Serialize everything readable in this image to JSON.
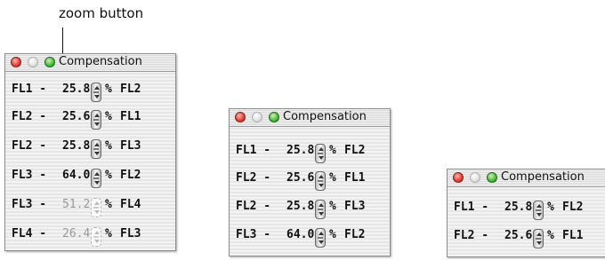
{
  "callout": {
    "label": "zoom button"
  },
  "windows": [
    {
      "title": "Compensation",
      "rows": [
        {
          "src": "FL1 -",
          "value": "25.8",
          "pct": "%",
          "dst": "FL2",
          "enabled": true
        },
        {
          "src": "FL2 -",
          "value": "25.6",
          "pct": "%",
          "dst": "FL1",
          "enabled": true
        },
        {
          "src": "FL2 -",
          "value": "25.8",
          "pct": "%",
          "dst": "FL3",
          "enabled": true
        },
        {
          "src": "FL3 -",
          "value": "64.0",
          "pct": "%",
          "dst": "FL2",
          "enabled": true
        },
        {
          "src": "FL3 -",
          "value": "51.2",
          "pct": "%",
          "dst": "FL4",
          "enabled": false
        },
        {
          "src": "FL4 -",
          "value": "26.4",
          "pct": "%",
          "dst": "FL3",
          "enabled": false
        }
      ]
    },
    {
      "title": "Compensation",
      "rows": [
        {
          "src": "FL1 -",
          "value": "25.8",
          "pct": "%",
          "dst": "FL2",
          "enabled": true
        },
        {
          "src": "FL2 -",
          "value": "25.6",
          "pct": "%",
          "dst": "FL1",
          "enabled": true
        },
        {
          "src": "FL2 -",
          "value": "25.8",
          "pct": "%",
          "dst": "FL3",
          "enabled": true
        },
        {
          "src": "FL3 -",
          "value": "64.0",
          "pct": "%",
          "dst": "FL2",
          "enabled": true
        }
      ]
    },
    {
      "title": "Compensation",
      "rows": [
        {
          "src": "FL1 -",
          "value": "25.8",
          "pct": "%",
          "dst": "FL2",
          "enabled": true
        },
        {
          "src": "FL2 -",
          "value": "25.6",
          "pct": "%",
          "dst": "FL1",
          "enabled": true
        }
      ]
    }
  ]
}
